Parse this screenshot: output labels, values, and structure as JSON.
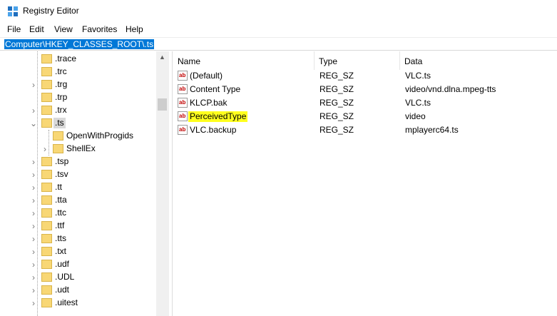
{
  "window": {
    "title": "Registry Editor",
    "icon": "regedit-icon"
  },
  "menu": [
    "File",
    "Edit",
    "View",
    "Favorites",
    "Help"
  ],
  "address": "Computer\\HKEY_CLASSES_ROOT\\.ts",
  "tree": [
    {
      "label": ".trace",
      "expander": ""
    },
    {
      "label": ".trc",
      "expander": ""
    },
    {
      "label": ".trg",
      "expander": "›"
    },
    {
      "label": ".trp",
      "expander": ""
    },
    {
      "label": ".trx",
      "expander": "›"
    },
    {
      "label": ".ts",
      "expander": "⌄",
      "selected": true
    },
    {
      "label": "OpenWithProgids",
      "expander": "",
      "child": true
    },
    {
      "label": "ShellEx",
      "expander": "›",
      "child": true
    },
    {
      "label": ".tsp",
      "expander": "›"
    },
    {
      "label": ".tsv",
      "expander": "›"
    },
    {
      "label": ".tt",
      "expander": "›"
    },
    {
      "label": ".tta",
      "expander": "›"
    },
    {
      "label": ".ttc",
      "expander": "›"
    },
    {
      "label": ".ttf",
      "expander": "›"
    },
    {
      "label": ".tts",
      "expander": "›"
    },
    {
      "label": ".txt",
      "expander": "›"
    },
    {
      "label": ".udf",
      "expander": "›"
    },
    {
      "label": ".UDL",
      "expander": "›"
    },
    {
      "label": ".udt",
      "expander": "›"
    },
    {
      "label": ".uitest",
      "expander": "›"
    }
  ],
  "columns": {
    "name": "Name",
    "type": "Type",
    "data": "Data"
  },
  "values": [
    {
      "name": "(Default)",
      "type": "REG_SZ",
      "data": "VLC.ts",
      "icon": "string-value-icon"
    },
    {
      "name": "Content Type",
      "type": "REG_SZ",
      "data": "video/vnd.dlna.mpeg-tts",
      "icon": "string-value-icon"
    },
    {
      "name": "KLCP.bak",
      "type": "REG_SZ",
      "data": "VLC.ts",
      "icon": "string-value-icon"
    },
    {
      "name": "PerceivedType",
      "type": "REG_SZ",
      "data": "video",
      "icon": "string-value-icon",
      "highlight_color": "#ffff1e"
    },
    {
      "name": "VLC.backup",
      "type": "REG_SZ",
      "data": "mplayerc64.ts",
      "icon": "string-value-icon"
    }
  ],
  "icon_glyph": "ab",
  "colors": {
    "selection": "#0078d7",
    "tree_selected": "#d9d9d9",
    "folder": "#f8d775",
    "highlight": "#ffff1e"
  }
}
